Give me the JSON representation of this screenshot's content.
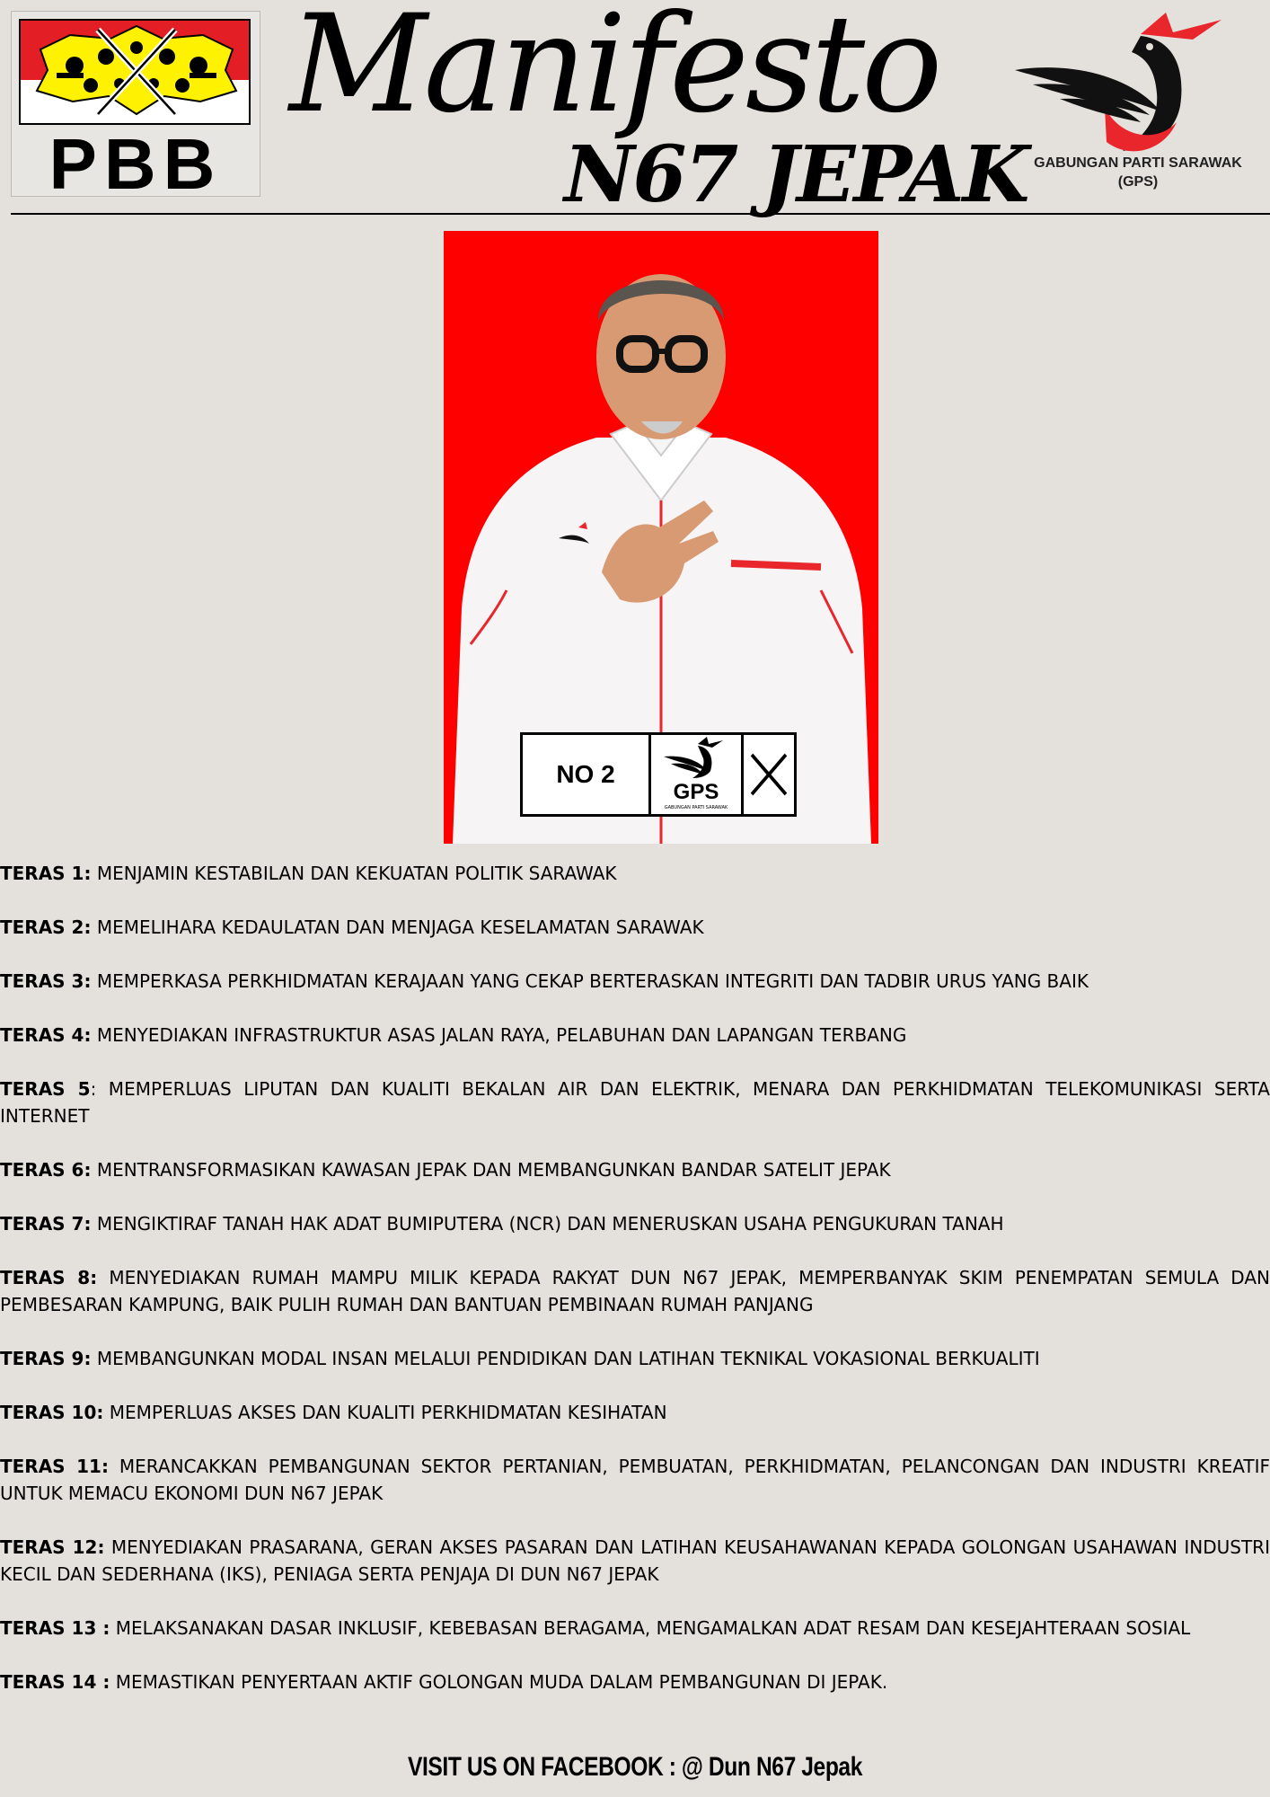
{
  "header": {
    "party_logo_text": "PBB",
    "title": "Manifesto",
    "subtitle": "N67 JEPAK",
    "coalition_logo_caption_line1": "GABUNGAN PARTI SARAWAK",
    "coalition_logo_caption_line2": "(GPS)"
  },
  "candidate": {
    "ballot_number": "NO 2",
    "ballot_symbol_text": "GPS",
    "ballot_symbol_subtext": "GABUNGAN PARTI SARAWAK"
  },
  "pillars": [
    {
      "label": "TERAS 1:",
      "text": " MENJAMIN KESTABILAN DAN KEKUATAN POLITIK SARAWAK"
    },
    {
      "label": "TERAS 2:",
      "text": " MEMELIHARA KEDAULATAN DAN MENJAGA KESELAMATAN SARAWAK"
    },
    {
      "label": "TERAS 3:",
      "text": " MEMPERKASA PERKHIDMATAN KERAJAAN YANG CEKAP BERTERASKAN INTEGRITI DAN TADBIR URUS YANG BAIK"
    },
    {
      "label": "TERAS 4:",
      "text": " MENYEDIAKAN INFRASTRUKTUR ASAS JALAN RAYA, PELABUHAN DAN LAPANGAN TERBANG"
    },
    {
      "label": "TERAS 5",
      "text": ": MEMPERLUAS LIPUTAN DAN KUALITI BEKALAN AIR DAN ELEKTRIK, MENARA DAN PERKHIDMATAN TELEKOMUNIKASI SERTA INTERNET"
    },
    {
      "label": "TERAS 6:",
      "text": " MENTRANSFORMASIKAN KAWASAN JEPAK DAN MEMBANGUNKAN BANDAR SATELIT JEPAK"
    },
    {
      "label": "TERAS 7:",
      "text": " MENGIKTIRAF TANAH HAK ADAT BUMIPUTERA (NCR) DAN MENERUSKAN USAHA PENGUKURAN TANAH"
    },
    {
      "label": "TERAS 8:",
      "text": " MENYEDIAKAN RUMAH MAMPU MILIK KEPADA RAKYAT DUN N67 JEPAK, MEMPERBANYAK SKIM PENEMPATAN SEMULA DAN PEMBESARAN KAMPUNG, BAIK PULIH RUMAH DAN BANTUAN PEMBINAAN RUMAH PANJANG"
    },
    {
      "label": "TERAS 9:",
      "text": " MEMBANGUNKAN MODAL INSAN MELALUI PENDIDIKAN DAN LATIHAN TEKNIKAL VOKASIONAL BERKUALITI"
    },
    {
      "label": "TERAS 10:",
      "text": " MEMPERLUAS AKSES DAN KUALITI PERKHIDMATAN KESIHATAN"
    },
    {
      "label": "TERAS 11:",
      "text": " MERANCAKKAN PEMBANGUNAN SEKTOR PERTANIAN, PEMBUATAN, PERKHIDMATAN, PELANCONGAN DAN INDUSTRI KREATIF UNTUK MEMACU EKONOMI DUN N67 JEPAK"
    },
    {
      "label": "TERAS 12:",
      "text": " MENYEDIAKAN PRASARANA, GERAN AKSES PASARAN DAN LATIHAN KEUSAHAWANAN KEPADA GOLONGAN USAHAWAN INDUSTRI KECIL DAN SEDERHANA (IKS), PENIAGA SERTA PENJAJA DI DUN N67 JEPAK"
    },
    {
      "label": "TERAS 13 :",
      "text": " MELAKSANAKAN DASAR INKLUSIF, KEBEBASAN BERAGAMA, MENGAMALKAN ADAT RESAM DAN KESEJAHTERAAN SOSIAL"
    },
    {
      "label": "TERAS 14 :",
      "text": " MEMASTIKAN PENYERTAAN AKTIF GOLONGAN MUDA DALAM PEMBANGUNAN DI JEPAK."
    }
  ],
  "footer": {
    "text": "VISIT US ON FACEBOOK : @ Dun N67 Jepak"
  }
}
